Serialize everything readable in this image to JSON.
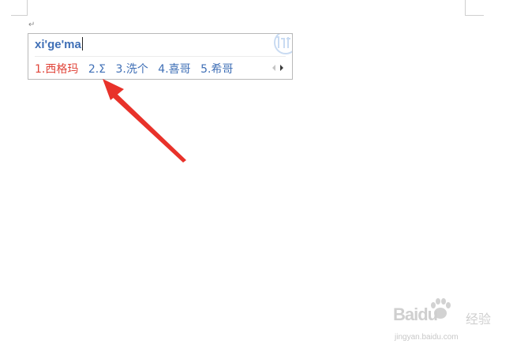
{
  "document": {
    "paragraph_mark": "↵"
  },
  "ime": {
    "composition": "xi'ge'ma",
    "candidates": [
      {
        "label": "1.西格玛",
        "active": true
      },
      {
        "label": "2.Σ",
        "active": false
      },
      {
        "label": "3.洗个",
        "active": false
      },
      {
        "label": "4.喜哥",
        "active": false
      },
      {
        "label": "5.希哥",
        "active": false
      }
    ],
    "pager": {
      "prev_icon": "triangle-left-icon",
      "next_icon": "triangle-right-icon"
    },
    "logo_icon": "ime-logo-icon"
  },
  "annotation": {
    "arrow_color": "#e8322a",
    "arrow_icon": "red-arrow-icon"
  },
  "watermark": {
    "brand": "Baidu",
    "brand_cn": "经验",
    "url": "jingyan.baidu.com"
  },
  "colors": {
    "active_candidate": "#e0453a",
    "candidate": "#3f6fb6",
    "composition": "#3f6fb6"
  }
}
